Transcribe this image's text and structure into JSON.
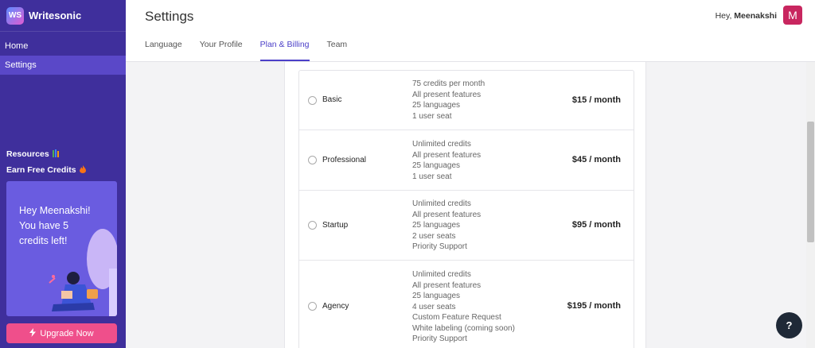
{
  "brand": {
    "name": "Writesonic",
    "logo": "WS"
  },
  "nav": [
    {
      "label": "Home",
      "active": false
    },
    {
      "label": "Settings",
      "active": true
    }
  ],
  "side_links": [
    {
      "label": "Resources",
      "icon": "books-icon"
    },
    {
      "label": "Earn Free Credits",
      "icon": "fire-icon"
    }
  ],
  "credit_card": {
    "text": "Hey Meenakshi! You have 5 credits left!"
  },
  "upgrade_label": "Upgrade Now",
  "header": {
    "title": "Settings",
    "greeting_prefix": "Hey,",
    "user_name": "Meenakshi",
    "avatar_letter": "M"
  },
  "tabs": [
    {
      "label": "Language",
      "active": false
    },
    {
      "label": "Your Profile",
      "active": false
    },
    {
      "label": "Plan & Billing",
      "active": true
    },
    {
      "label": "Team",
      "active": false
    }
  ],
  "plans": [
    {
      "name": "Basic",
      "features": [
        "75 credits per month",
        "All present features",
        "25 languages",
        "1 user seat"
      ],
      "price": "$15 / month"
    },
    {
      "name": "Professional",
      "features": [
        "Unlimited credits",
        "All present features",
        "25 languages",
        "1 user seat"
      ],
      "price": "$45 / month"
    },
    {
      "name": "Startup",
      "features": [
        "Unlimited credits",
        "All present features",
        "25 languages",
        "2 user seats",
        "Priority Support"
      ],
      "price": "$95 / month"
    },
    {
      "name": "Agency",
      "features": [
        "Unlimited credits",
        "All present features",
        "25 languages",
        "4 user seats",
        "Custom Feature Request",
        "White labeling (coming soon)",
        "Priority Support"
      ],
      "price": "$195 / month"
    }
  ],
  "help_label": "?",
  "colors": {
    "sidebar": "#3f2f9c",
    "accent": "#4b3fc8",
    "upgrade": "#ef4f8b",
    "avatar": "#c8265f"
  }
}
